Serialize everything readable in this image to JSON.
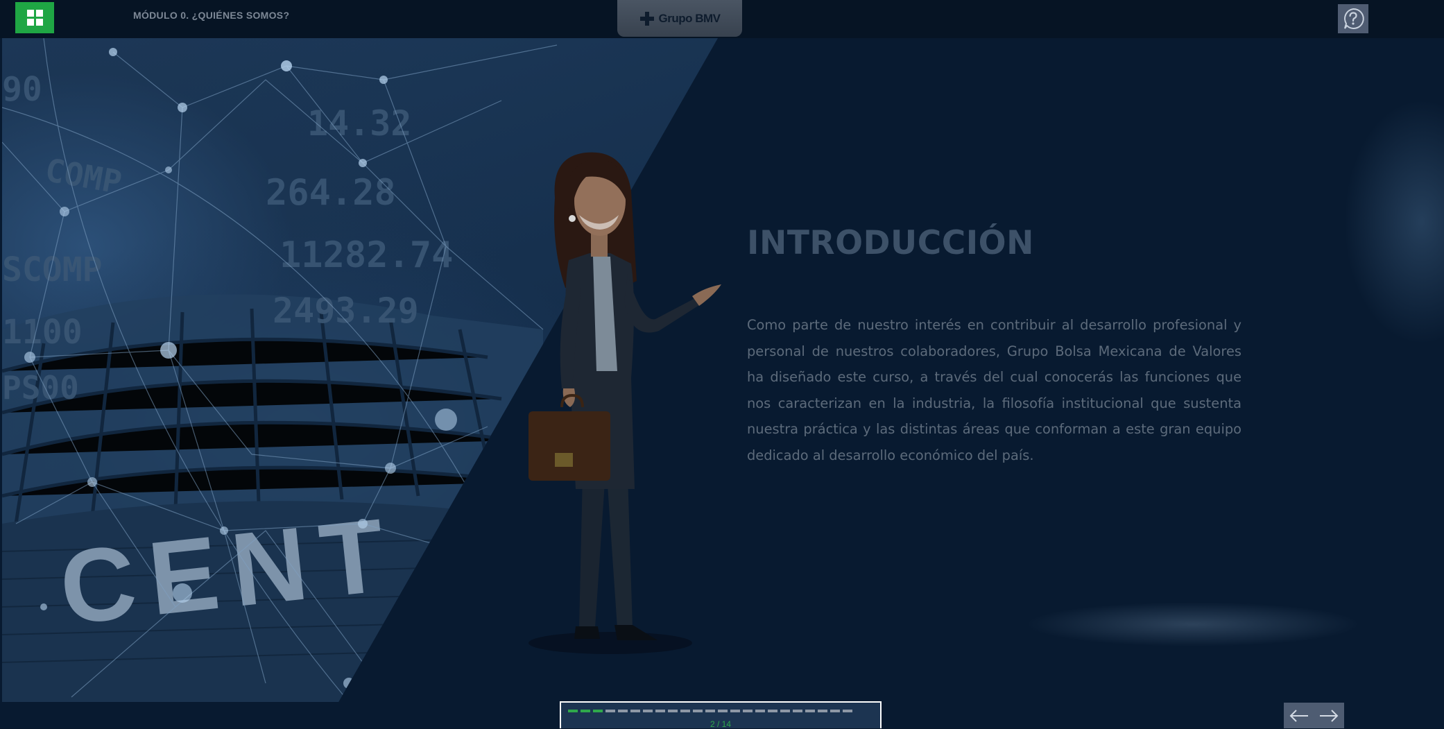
{
  "header": {
    "module_title": "MÓDULO 0. ¿QUIÉNES SOMOS?",
    "brand": "Grupo BMV",
    "menu_icon": "grid-icon",
    "help_icon": "help-chat-icon"
  },
  "hero": {
    "building_sign": "CENT",
    "ticker_lines": [
      "90",
      "COMP",
      "14.32",
      "264.28",
      "11282.74",
      "SCOMP",
      "2493.29",
      "1100",
      "PS00"
    ]
  },
  "content": {
    "title": "INTRODUCCIÓN",
    "body": "Como parte de nuestro interés en contribuir al desarrollo profesional y personal de nuestros colaboradores, Grupo Bolsa Mexicana de Valores ha diseñado este curso, a través del cual conocerás las funciones que nos caracterizan en la industria, la filosofía institucional que sustenta nuestra práctica y las distintas áreas que conforman a este gran equipo dedicado al desarrollo económico del país."
  },
  "progress": {
    "current": 2,
    "total": 14,
    "label": "2 / 14",
    "segments_completed": 3,
    "segments_total": 23
  },
  "nav": {
    "prev_icon": "arrow-left-icon",
    "next_icon": "arrow-right-icon"
  },
  "colors": {
    "accent_green": "#1fa644",
    "background": "#081a30",
    "title": "#3d5168",
    "body_text": "#5d6b7b"
  }
}
